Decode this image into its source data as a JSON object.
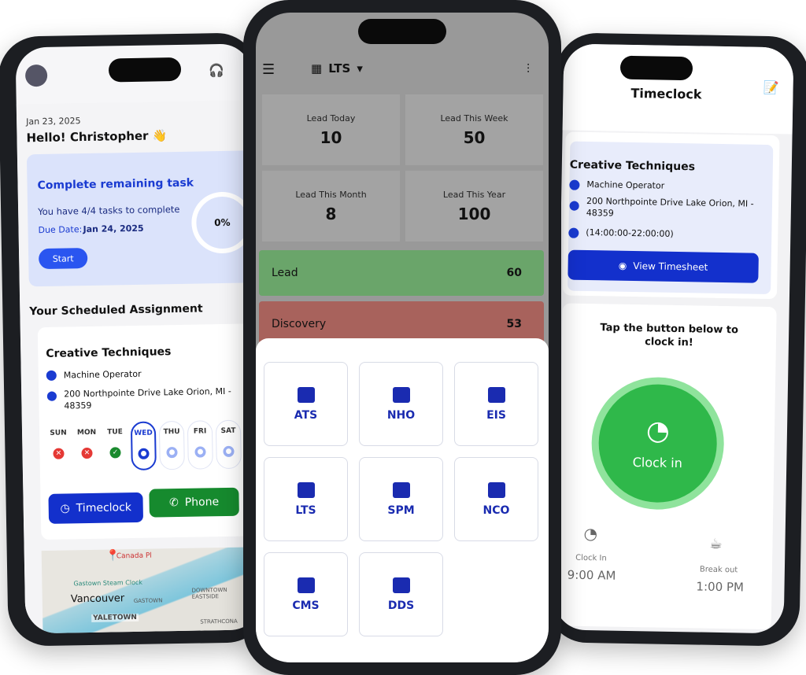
{
  "left": {
    "date": "Jan 23, 2025",
    "greeting": "Hello! Christopher 👋",
    "task_title": "Complete remaining task",
    "task_sub": "You have 4/4 tasks to complete",
    "due_label": "Due Date:",
    "due_value": "Jan 24, 2025",
    "progress": "0%",
    "start": "Start",
    "section": "Your Scheduled Assignment",
    "company": "Creative Techniques",
    "role": "Machine Operator",
    "address": "200 Northpointe Drive Lake Orion, MI - 48359",
    "days": [
      {
        "d": "SUN",
        "s": "missed"
      },
      {
        "d": "MON",
        "s": "missed"
      },
      {
        "d": "TUE",
        "s": "done"
      },
      {
        "d": "WED",
        "s": "current"
      },
      {
        "d": "THU",
        "s": "upcoming"
      },
      {
        "d": "FRI",
        "s": "upcoming"
      },
      {
        "d": "SAT",
        "s": "upcoming"
      }
    ],
    "timeclock": "Timeclock",
    "phone": "Phone",
    "map": {
      "city": "Vancouver",
      "place": "Canada Pl",
      "poi": "Gastown Steam Clock",
      "area1": "GASTOWN",
      "area2": "DOWNTOWN EASTSIDE",
      "area3": "STRATHCONA",
      "area4": "YALETOWN"
    }
  },
  "middle": {
    "org": "LTS",
    "stats": [
      {
        "label": "Lead Today",
        "value": "10"
      },
      {
        "label": "Lead This Week",
        "value": "50"
      },
      {
        "label": "Lead This Month",
        "value": "8"
      },
      {
        "label": "Lead This Year",
        "value": "100"
      }
    ],
    "bars": [
      {
        "label": "Lead",
        "value": "60",
        "color": "#6aa56a"
      },
      {
        "label": "Discovery",
        "value": "53",
        "color": "#a8625c"
      }
    ],
    "modules": [
      "ATS",
      "NHO",
      "EIS",
      "LTS",
      "SPM",
      "NCO",
      "CMS",
      "DDS"
    ]
  },
  "right": {
    "title": "Timeclock",
    "company": "Creative Techniques",
    "role": "Machine Operator",
    "address": "200 Northpointe Drive Lake Orion, MI - 48359",
    "shift": "(14:00:00-22:00:00)",
    "view": "View Timesheet",
    "prompt": "Tap the button below to clock in!",
    "clock_btn": "Clock in",
    "clock_in_label": "Clock In",
    "clock_in_time": "9:00 AM",
    "break_label": "Break out",
    "break_time": "1:00 PM"
  },
  "colors": {
    "primary": "#1a3bd1",
    "green": "#21a038",
    "accent": "#1a2bb0"
  }
}
